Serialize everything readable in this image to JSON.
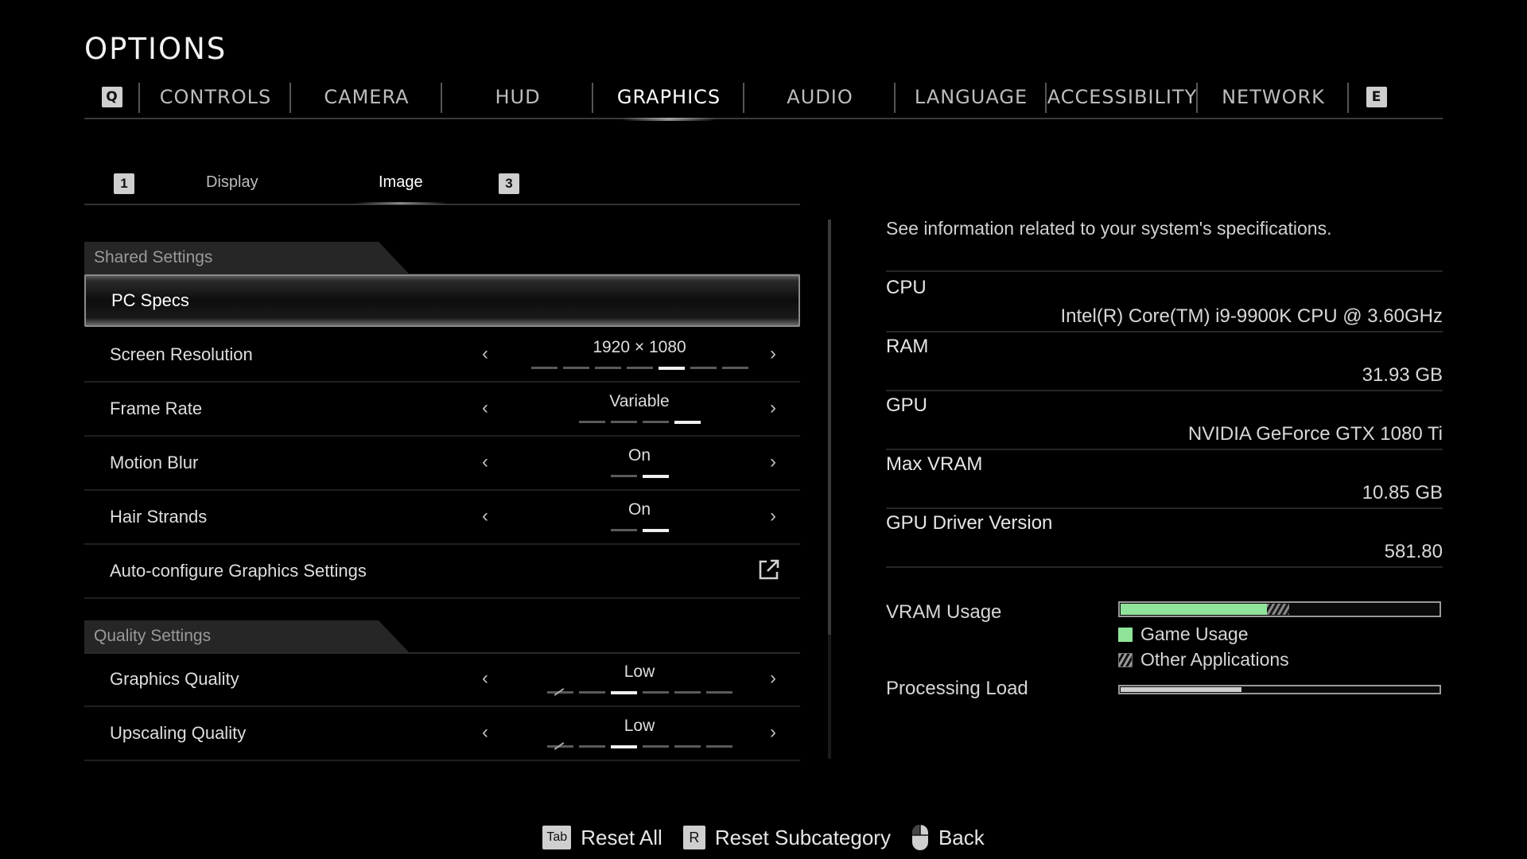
{
  "header": {
    "title": "OPTIONS"
  },
  "tabs": {
    "left_key": "Q",
    "right_key": "E",
    "items": [
      {
        "label": "CONTROLS"
      },
      {
        "label": "CAMERA"
      },
      {
        "label": "HUD"
      },
      {
        "label": "GRAPHICS",
        "active": true
      },
      {
        "label": "AUDIO"
      },
      {
        "label": "LANGUAGE"
      },
      {
        "label": "ACCESSIBILITY"
      },
      {
        "label": "NETWORK"
      }
    ]
  },
  "subtabs": {
    "left_key": "1",
    "right_key": "3",
    "items": [
      {
        "label": "Display"
      },
      {
        "label": "Image",
        "active": true
      }
    ]
  },
  "sections": {
    "shared": "Shared Settings",
    "quality": "Quality Settings"
  },
  "rows": {
    "pc_specs": {
      "label": "PC Specs"
    },
    "screen_resolution": {
      "label": "Screen Resolution",
      "value": "1920 × 1080",
      "steps": 7,
      "selected_step": 5
    },
    "frame_rate": {
      "label": "Frame Rate",
      "value": "Variable",
      "steps": 4,
      "selected_step": 4
    },
    "motion_blur": {
      "label": "Motion Blur",
      "value": "On",
      "steps": 2,
      "selected_step": 2
    },
    "hair_strands": {
      "label": "Hair Strands",
      "value": "On",
      "steps": 2,
      "selected_step": 2
    },
    "auto_configure": {
      "label": "Auto-configure Graphics Settings",
      "icon": "external-link-icon"
    },
    "graphics_quality": {
      "label": "Graphics Quality",
      "value": "Low",
      "steps": 6,
      "selected_step": 3
    },
    "upscaling_quality": {
      "label": "Upscaling Quality",
      "value": "Low",
      "steps": 6,
      "selected_step": 3
    }
  },
  "info": {
    "description": "See information related to your system's specifications.",
    "specs": [
      {
        "key": "CPU",
        "value": "Intel(R) Core(TM) i9-9900K CPU @ 3.60GHz"
      },
      {
        "key": "RAM",
        "value": "31.93 GB"
      },
      {
        "key": "GPU",
        "value": "NVIDIA GeForce GTX 1080 Ti"
      },
      {
        "key": "Max VRAM",
        "value": "10.85 GB"
      },
      {
        "key": "GPU Driver Version",
        "value": "581.80"
      }
    ],
    "vram_usage": {
      "label": "VRAM Usage",
      "game_fraction": 0.46,
      "other_fraction": 0.07
    },
    "legend": {
      "game": "Game Usage",
      "other": "Other Applications"
    },
    "processing_load": {
      "label": "Processing Load",
      "fraction": 0.38
    },
    "colors": {
      "game_usage": "#8fe49a",
      "processing_load": "#cfcfcf"
    }
  },
  "footer": {
    "reset_all_key": "Tab",
    "reset_all": "Reset All",
    "reset_sub_key": "R",
    "reset_sub": "Reset Subcategory",
    "back": "Back",
    "back_icon": "mouse-icon"
  }
}
